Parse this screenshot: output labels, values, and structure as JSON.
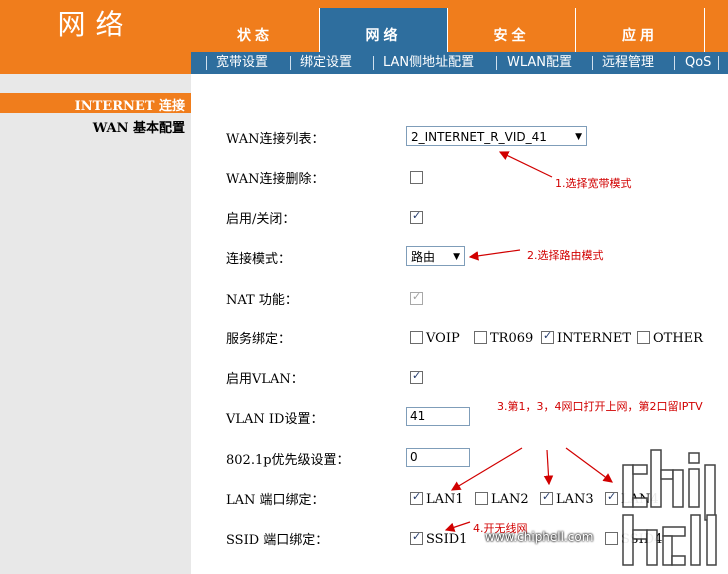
{
  "header": {
    "title": "网络",
    "tabs": [
      {
        "label": "状态",
        "active": false
      },
      {
        "label": "网络",
        "active": true
      },
      {
        "label": "安全",
        "active": false
      },
      {
        "label": "应用",
        "active": false
      }
    ],
    "subnav": [
      "宽带设置",
      "绑定设置",
      "LAN侧地址配置",
      "WLAN配置",
      "远程管理",
      "QoS"
    ]
  },
  "sidebar": {
    "items": [
      {
        "label": "INTERNET 连接",
        "active": true
      },
      {
        "label": "WAN 基本配置",
        "active": false
      }
    ]
  },
  "form": {
    "wan_list": {
      "label": "WAN连接列表：",
      "value": "2_INTERNET_R_VID_41"
    },
    "wan_delete": {
      "label": "WAN连接删除：",
      "checked": false
    },
    "enable": {
      "label": "启用/关闭：",
      "checked": true
    },
    "mode": {
      "label": "连接模式：",
      "value": "路由"
    },
    "nat": {
      "label": "NAT 功能：",
      "checked": true,
      "disabled": true
    },
    "service": {
      "label": "服务绑定：",
      "options": [
        {
          "label": "VOIP",
          "checked": false
        },
        {
          "label": "TR069",
          "checked": false
        },
        {
          "label": "INTERNET",
          "checked": true
        },
        {
          "label": "OTHER",
          "checked": false
        }
      ]
    },
    "vlan_enable": {
      "label": "启用VLAN：",
      "checked": true
    },
    "vlan_id": {
      "label": "VLAN ID设置：",
      "value": "41"
    },
    "priority": {
      "label": "802.1p优先级设置：",
      "value": "0"
    },
    "lan_bind": {
      "label": "LAN 端口绑定：",
      "options": [
        {
          "label": "LAN1",
          "checked": true
        },
        {
          "label": "LAN2",
          "checked": false
        },
        {
          "label": "LAN3",
          "checked": true
        },
        {
          "label": "LAN4",
          "checked": true
        }
      ]
    },
    "ssid_bind": {
      "label": "SSID 端口绑定：",
      "options": [
        {
          "label": "SSID1",
          "checked": true
        },
        {
          "label": "SSID4",
          "checked": false
        }
      ]
    }
  },
  "annotations": {
    "a1": "1.选择宽带模式",
    "a2": "2.选择路由模式",
    "a3": "3.第1，3，4网口打开上网，第2口留IPTV",
    "a4": "4.开无线网"
  },
  "watermark": {
    "site": "www.chiphell.com"
  },
  "colors": {
    "orange": "#f07d1c",
    "blue": "#2e6e9e",
    "sidebar": "#e8e8e8",
    "annotation": "#d10000"
  }
}
